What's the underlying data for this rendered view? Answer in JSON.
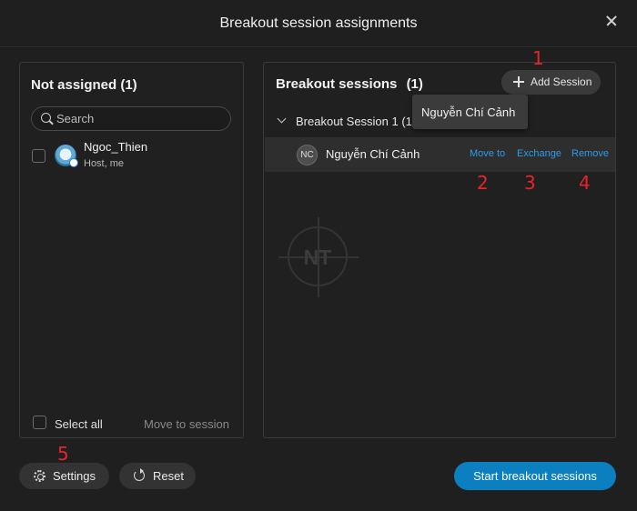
{
  "dialog": {
    "title": "Breakout session assignments"
  },
  "not_assigned": {
    "title": "Not assigned (1)",
    "search_placeholder": "Search",
    "participants": [
      {
        "name": "Ngoc_Thien",
        "role": "Host, me"
      }
    ],
    "select_all_label": "Select all",
    "move_to_session_label": "Move to session"
  },
  "breakout": {
    "title": "Breakout sessions",
    "count": "(1)",
    "add_session_label": "Add Session",
    "tooltip": "Nguyễn Chí Cảnh",
    "sessions": [
      {
        "name": "Breakout Session 1 (1",
        "members": [
          {
            "initials": "NC",
            "name": "Nguyễn Chí Cảnh"
          }
        ]
      }
    ],
    "actions": {
      "move_to": "Move to",
      "exchange": "Exchange",
      "remove": "Remove"
    }
  },
  "watermark": "NT",
  "footer": {
    "settings_label": "Settings",
    "reset_label": "Reset",
    "start_label": "Start breakout sessions"
  },
  "annotations": [
    "1",
    "2",
    "3",
    "4",
    "5"
  ],
  "colors": {
    "accent": "#0c7fc0",
    "link": "#2f9be6",
    "annotation": "#e8232a",
    "background": "#1f1f1f"
  }
}
